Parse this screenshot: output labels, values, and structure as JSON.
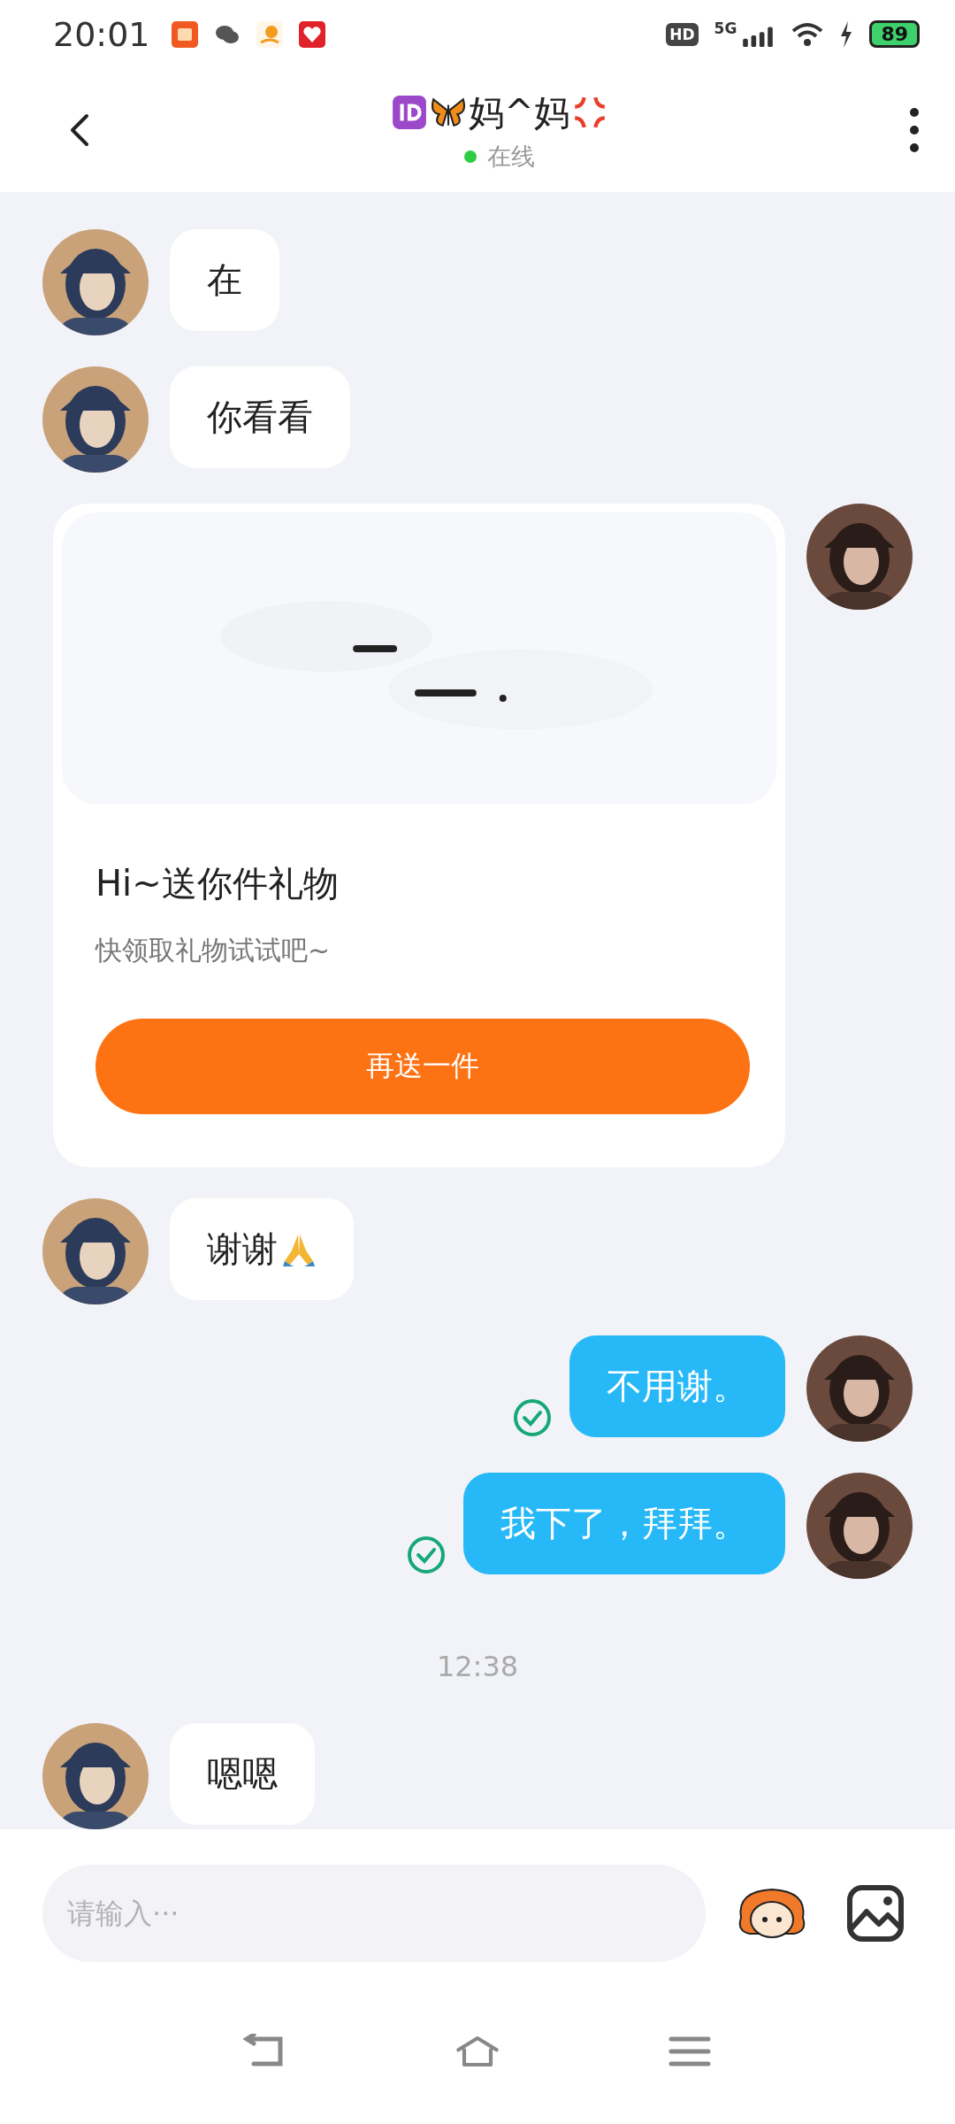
{
  "status_bar": {
    "time": "20:01",
    "hd": "HD",
    "network": "5G",
    "battery": "89"
  },
  "header": {
    "title": "妈^妈",
    "presence": "在线",
    "online": true
  },
  "messages": [
    {
      "kind": "incoming",
      "text": "在"
    },
    {
      "kind": "incoming",
      "text": "你看看"
    },
    {
      "kind": "gift",
      "title": "Hi~送你件礼物",
      "subtitle": "快领取礼物试试吧~",
      "button": "再送一件"
    },
    {
      "kind": "incoming_emoji",
      "text": "谢谢"
    },
    {
      "kind": "outgoing",
      "text": "不用谢。",
      "read": true
    },
    {
      "kind": "outgoing",
      "text": "我下了，拜拜。",
      "read": true
    },
    {
      "kind": "time",
      "text": "12:38"
    },
    {
      "kind": "incoming",
      "text": "嗯嗯"
    }
  ],
  "composer": {
    "placeholder": "请输入···"
  }
}
